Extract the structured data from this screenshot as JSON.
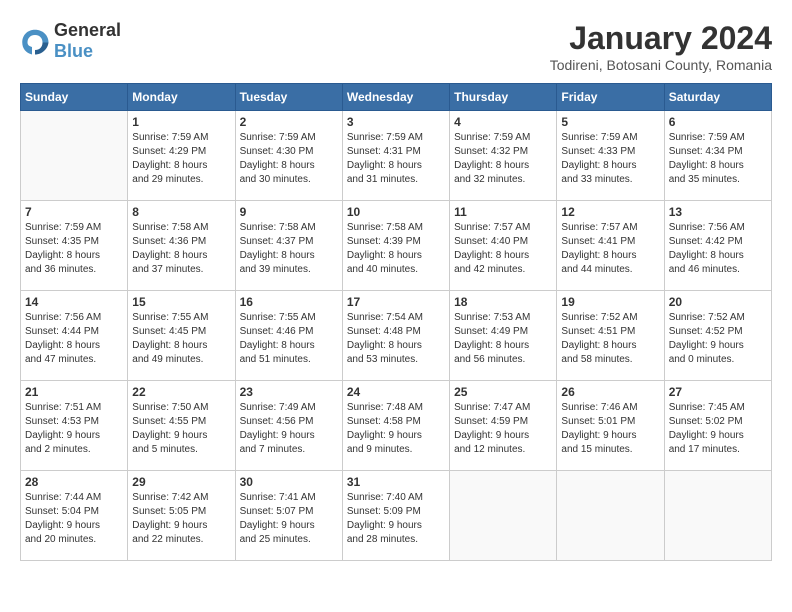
{
  "logo": {
    "general": "General",
    "blue": "Blue"
  },
  "title": "January 2024",
  "location": "Todireni, Botosani County, Romania",
  "weekdays": [
    "Sunday",
    "Monday",
    "Tuesday",
    "Wednesday",
    "Thursday",
    "Friday",
    "Saturday"
  ],
  "weeks": [
    [
      {
        "day": "",
        "info": ""
      },
      {
        "day": "1",
        "info": "Sunrise: 7:59 AM\nSunset: 4:29 PM\nDaylight: 8 hours\nand 29 minutes."
      },
      {
        "day": "2",
        "info": "Sunrise: 7:59 AM\nSunset: 4:30 PM\nDaylight: 8 hours\nand 30 minutes."
      },
      {
        "day": "3",
        "info": "Sunrise: 7:59 AM\nSunset: 4:31 PM\nDaylight: 8 hours\nand 31 minutes."
      },
      {
        "day": "4",
        "info": "Sunrise: 7:59 AM\nSunset: 4:32 PM\nDaylight: 8 hours\nand 32 minutes."
      },
      {
        "day": "5",
        "info": "Sunrise: 7:59 AM\nSunset: 4:33 PM\nDaylight: 8 hours\nand 33 minutes."
      },
      {
        "day": "6",
        "info": "Sunrise: 7:59 AM\nSunset: 4:34 PM\nDaylight: 8 hours\nand 35 minutes."
      }
    ],
    [
      {
        "day": "7",
        "info": "Sunrise: 7:59 AM\nSunset: 4:35 PM\nDaylight: 8 hours\nand 36 minutes."
      },
      {
        "day": "8",
        "info": "Sunrise: 7:58 AM\nSunset: 4:36 PM\nDaylight: 8 hours\nand 37 minutes."
      },
      {
        "day": "9",
        "info": "Sunrise: 7:58 AM\nSunset: 4:37 PM\nDaylight: 8 hours\nand 39 minutes."
      },
      {
        "day": "10",
        "info": "Sunrise: 7:58 AM\nSunset: 4:39 PM\nDaylight: 8 hours\nand 40 minutes."
      },
      {
        "day": "11",
        "info": "Sunrise: 7:57 AM\nSunset: 4:40 PM\nDaylight: 8 hours\nand 42 minutes."
      },
      {
        "day": "12",
        "info": "Sunrise: 7:57 AM\nSunset: 4:41 PM\nDaylight: 8 hours\nand 44 minutes."
      },
      {
        "day": "13",
        "info": "Sunrise: 7:56 AM\nSunset: 4:42 PM\nDaylight: 8 hours\nand 46 minutes."
      }
    ],
    [
      {
        "day": "14",
        "info": "Sunrise: 7:56 AM\nSunset: 4:44 PM\nDaylight: 8 hours\nand 47 minutes."
      },
      {
        "day": "15",
        "info": "Sunrise: 7:55 AM\nSunset: 4:45 PM\nDaylight: 8 hours\nand 49 minutes."
      },
      {
        "day": "16",
        "info": "Sunrise: 7:55 AM\nSunset: 4:46 PM\nDaylight: 8 hours\nand 51 minutes."
      },
      {
        "day": "17",
        "info": "Sunrise: 7:54 AM\nSunset: 4:48 PM\nDaylight: 8 hours\nand 53 minutes."
      },
      {
        "day": "18",
        "info": "Sunrise: 7:53 AM\nSunset: 4:49 PM\nDaylight: 8 hours\nand 56 minutes."
      },
      {
        "day": "19",
        "info": "Sunrise: 7:52 AM\nSunset: 4:51 PM\nDaylight: 8 hours\nand 58 minutes."
      },
      {
        "day": "20",
        "info": "Sunrise: 7:52 AM\nSunset: 4:52 PM\nDaylight: 9 hours\nand 0 minutes."
      }
    ],
    [
      {
        "day": "21",
        "info": "Sunrise: 7:51 AM\nSunset: 4:53 PM\nDaylight: 9 hours\nand 2 minutes."
      },
      {
        "day": "22",
        "info": "Sunrise: 7:50 AM\nSunset: 4:55 PM\nDaylight: 9 hours\nand 5 minutes."
      },
      {
        "day": "23",
        "info": "Sunrise: 7:49 AM\nSunset: 4:56 PM\nDaylight: 9 hours\nand 7 minutes."
      },
      {
        "day": "24",
        "info": "Sunrise: 7:48 AM\nSunset: 4:58 PM\nDaylight: 9 hours\nand 9 minutes."
      },
      {
        "day": "25",
        "info": "Sunrise: 7:47 AM\nSunset: 4:59 PM\nDaylight: 9 hours\nand 12 minutes."
      },
      {
        "day": "26",
        "info": "Sunrise: 7:46 AM\nSunset: 5:01 PM\nDaylight: 9 hours\nand 15 minutes."
      },
      {
        "day": "27",
        "info": "Sunrise: 7:45 AM\nSunset: 5:02 PM\nDaylight: 9 hours\nand 17 minutes."
      }
    ],
    [
      {
        "day": "28",
        "info": "Sunrise: 7:44 AM\nSunset: 5:04 PM\nDaylight: 9 hours\nand 20 minutes."
      },
      {
        "day": "29",
        "info": "Sunrise: 7:42 AM\nSunset: 5:05 PM\nDaylight: 9 hours\nand 22 minutes."
      },
      {
        "day": "30",
        "info": "Sunrise: 7:41 AM\nSunset: 5:07 PM\nDaylight: 9 hours\nand 25 minutes."
      },
      {
        "day": "31",
        "info": "Sunrise: 7:40 AM\nSunset: 5:09 PM\nDaylight: 9 hours\nand 28 minutes."
      },
      {
        "day": "",
        "info": ""
      },
      {
        "day": "",
        "info": ""
      },
      {
        "day": "",
        "info": ""
      }
    ]
  ]
}
